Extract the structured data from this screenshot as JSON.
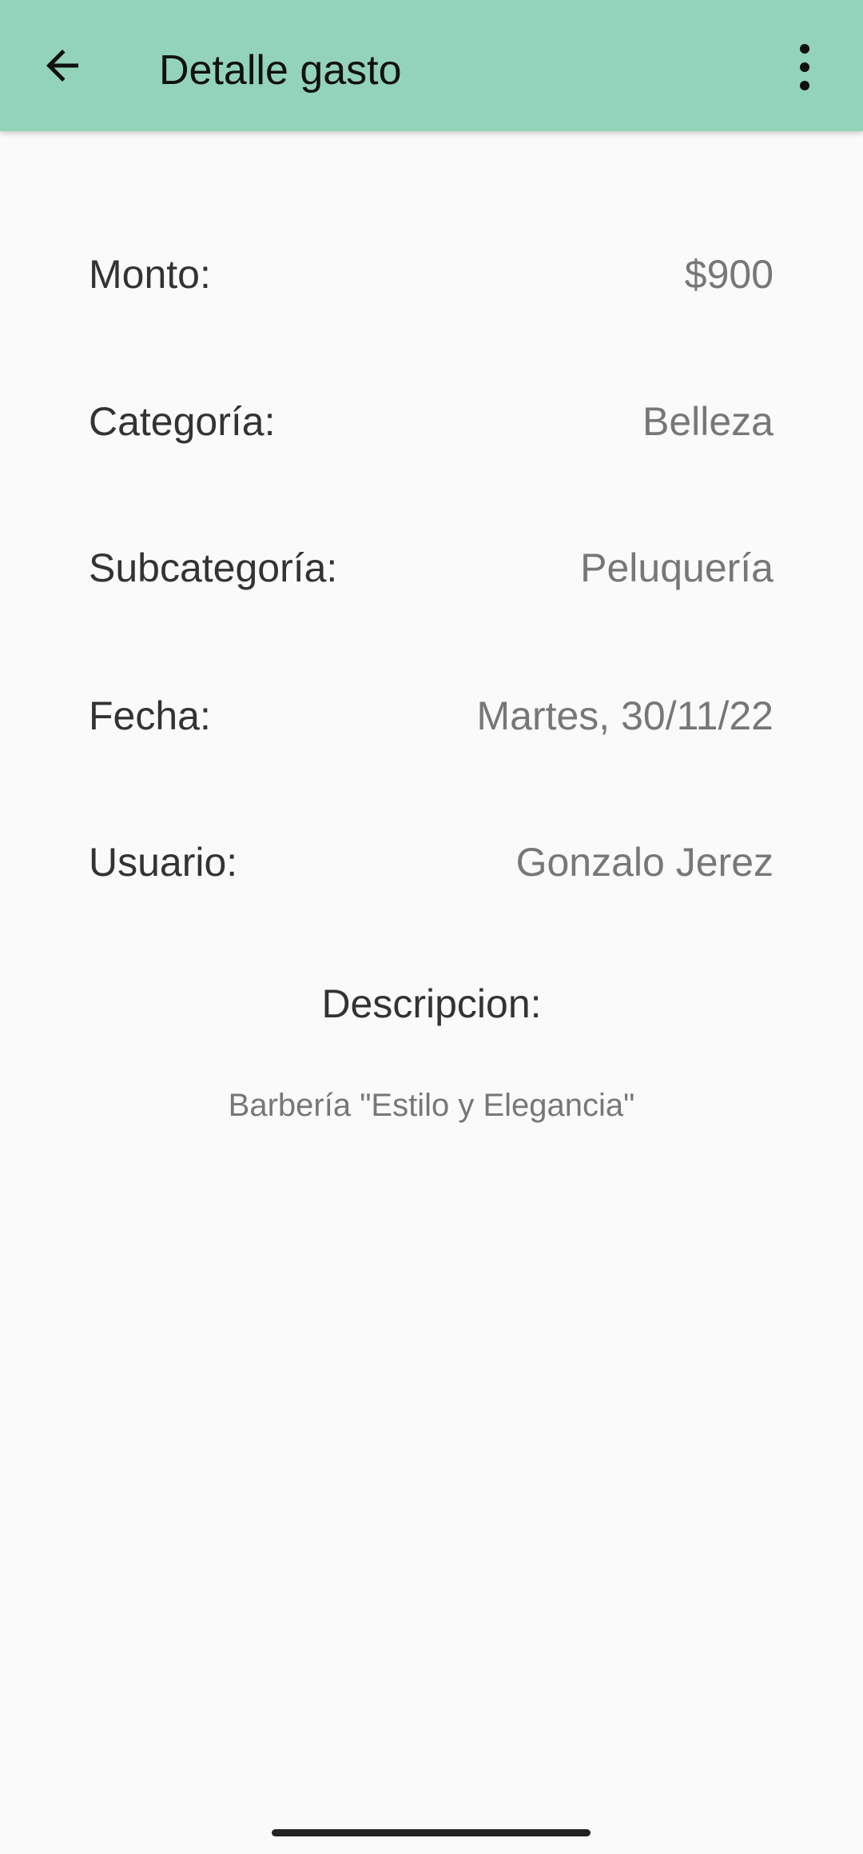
{
  "toolbar": {
    "title": "Detalle gasto",
    "back_icon": "arrow-back-icon",
    "menu_icon": "more-vert-icon",
    "color": "#93d3b9"
  },
  "details": [
    {
      "label": "Monto:",
      "value": "$900"
    },
    {
      "label": "Categoría:",
      "value": "Belleza"
    },
    {
      "label": "Subcategoría:",
      "value": "Peluquería"
    },
    {
      "label": "Fecha:",
      "value": "Martes, 30/11/22"
    },
    {
      "label": "Usuario:",
      "value": "Gonzalo Jerez"
    }
  ],
  "description": {
    "label": "Descripcion:",
    "text": "Barbería \"Estilo y Elegancia\""
  }
}
